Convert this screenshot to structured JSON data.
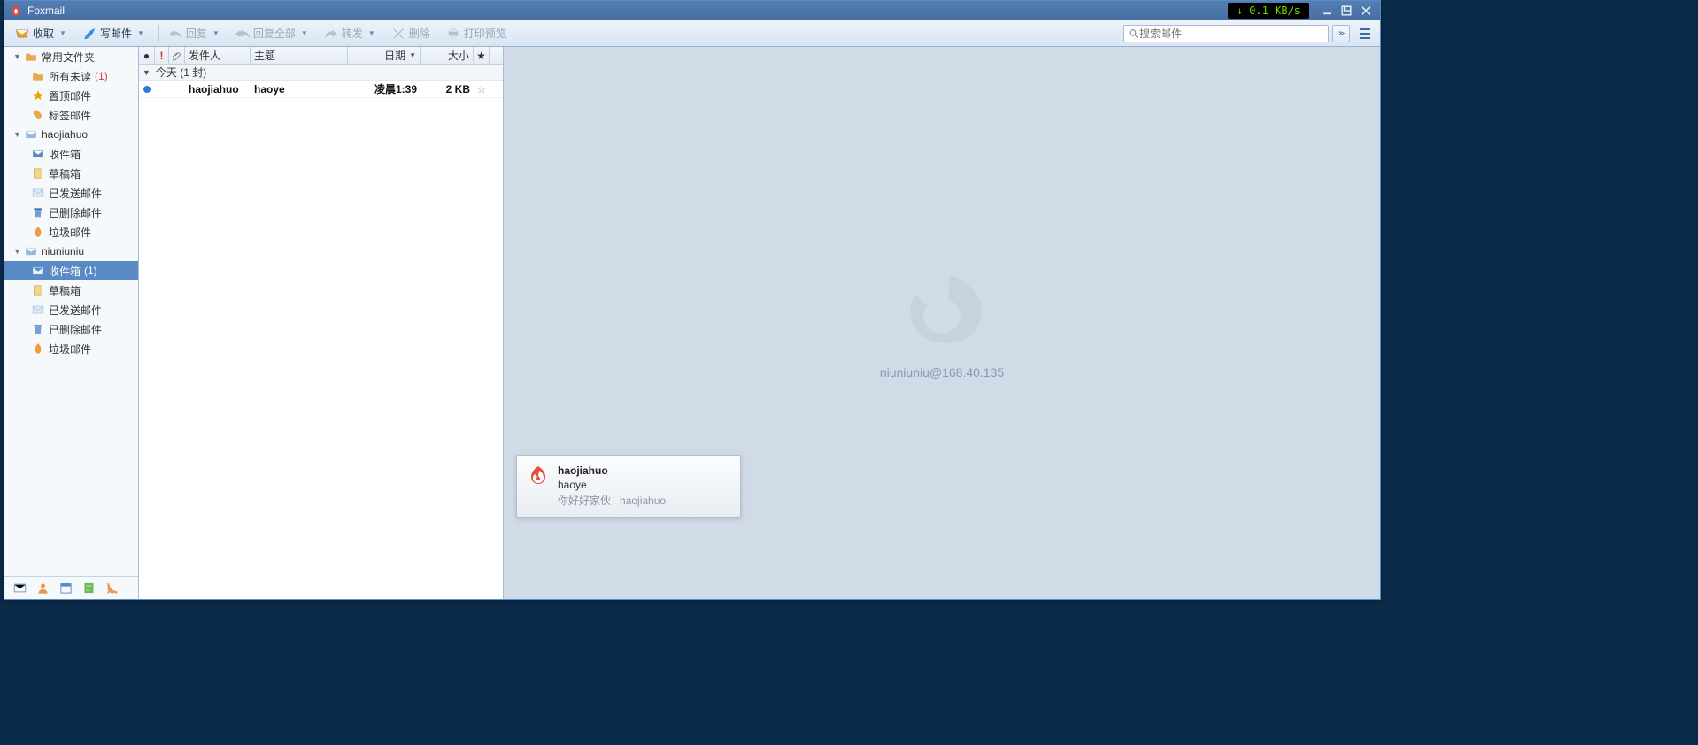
{
  "titlebar": {
    "app_name": "Foxmail",
    "net_speed": "↓ 0.1 KB/s"
  },
  "toolbar": {
    "receive": "收取",
    "compose": "写邮件",
    "reply": "回复",
    "reply_all": "回复全部",
    "forward": "转发",
    "delete": "删除",
    "print_preview": "打印预览",
    "search_placeholder": "搜索邮件"
  },
  "sidebar": {
    "common": {
      "label": "常用文件夹"
    },
    "all_unread": {
      "label": "所有未读",
      "count": "(1)"
    },
    "pinned": {
      "label": "置顶邮件"
    },
    "tagged": {
      "label": "标签邮件"
    },
    "acct1": {
      "label": "haojiahuo",
      "inbox": "收件箱",
      "drafts": "草稿箱",
      "sent": "已发送邮件",
      "deleted": "已删除邮件",
      "junk": "垃圾邮件"
    },
    "acct2": {
      "label": "niuniuniu",
      "inbox": "收件箱",
      "inbox_count": "(1)",
      "drafts": "草稿箱",
      "sent": "已发送邮件",
      "deleted": "已删除邮件",
      "junk": "垃圾邮件"
    }
  },
  "list": {
    "headers": {
      "from": "发件人",
      "subject": "主题",
      "date": "日期",
      "size": "大小"
    },
    "group": "今天 (1 封)",
    "row0": {
      "from": "haojiahuo",
      "subject": "haoye",
      "date": "凌晨1:39",
      "size": "2 KB"
    }
  },
  "preview": {
    "email": "niuniuniu@168.40.135"
  },
  "toast": {
    "title": "haojiahuo",
    "subject": "haoye",
    "preview_a": "你好好家伙",
    "preview_b": "haojiahuo"
  }
}
